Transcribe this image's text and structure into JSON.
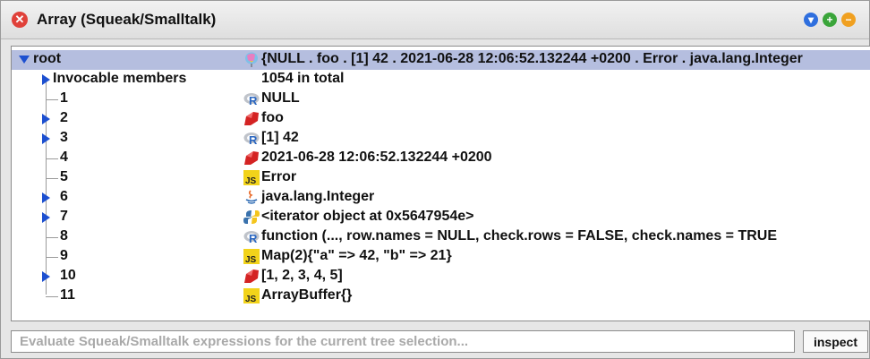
{
  "window": {
    "title": "Array (Squeak/Smalltalk)",
    "close_glyph": "✕",
    "controls": [
      {
        "name": "collapse-window-icon",
        "glyph": "▾",
        "color": "#2f6fde"
      },
      {
        "name": "expand-window-icon",
        "glyph": "+",
        "color": "#3aa53a"
      },
      {
        "name": "minimize-window-icon",
        "glyph": "−",
        "color": "#f0a020"
      }
    ]
  },
  "tree": {
    "rows": [
      {
        "name": "root",
        "value": "{NULL . foo . [1] 42 . 2021-06-28 12:06:52.132244 +0200 . Error . java.lang.Integer",
        "icon": "balloon-icon",
        "expander": "expanded"
      },
      {
        "name": "Invocable members",
        "value": "1054 in total",
        "icon": "",
        "expander": "collapsed"
      },
      {
        "name": "1",
        "value": "NULL",
        "icon": "r-language-icon",
        "expander": "none"
      },
      {
        "name": "2",
        "value": "foo",
        "icon": "ruby-icon",
        "expander": "collapsed"
      },
      {
        "name": "3",
        "value": "[1] 42",
        "icon": "r-language-icon",
        "expander": "collapsed"
      },
      {
        "name": "4",
        "value": "2021-06-28 12:06:52.132244 +0200",
        "icon": "ruby-icon",
        "expander": "none"
      },
      {
        "name": "5",
        "value": "Error",
        "icon": "javascript-icon",
        "expander": "none"
      },
      {
        "name": "6",
        "value": "java.lang.Integer",
        "icon": "java-icon",
        "expander": "collapsed"
      },
      {
        "name": "7",
        "value": "<iterator object at 0x5647954e>",
        "icon": "python-icon",
        "expander": "collapsed"
      },
      {
        "name": "8",
        "value": "function (..., row.names = NULL, check.rows = FALSE, check.names = TRUE",
        "icon": "r-language-icon",
        "expander": "none"
      },
      {
        "name": "9",
        "value": "Map(2){\"a\" => 42, \"b\" => 21}",
        "icon": "javascript-icon",
        "expander": "none"
      },
      {
        "name": "10",
        "value": "[1, 2, 3, 4, 5]",
        "icon": "ruby-icon",
        "expander": "collapsed"
      },
      {
        "name": "11",
        "value": "ArrayBuffer{}",
        "icon": "javascript-icon",
        "expander": "none"
      }
    ]
  },
  "evaluator": {
    "placeholder": "Evaluate Squeak/Smalltalk expressions for the current tree selection...",
    "value": "",
    "inspect_label": "inspect",
    "icon_text": {
      "javascript": "JS",
      "r": "R"
    }
  },
  "colors": {
    "selection": "#b5bedf",
    "expander": "#1c4fd0",
    "close": "#e0413a",
    "ruby": "#d42323",
    "javascript": "#f2d31a",
    "r_grey": "#bfc3ca",
    "r_blue": "#2a66c0",
    "python_blue": "#3a72ad",
    "python_yellow": "#f4c51c"
  }
}
